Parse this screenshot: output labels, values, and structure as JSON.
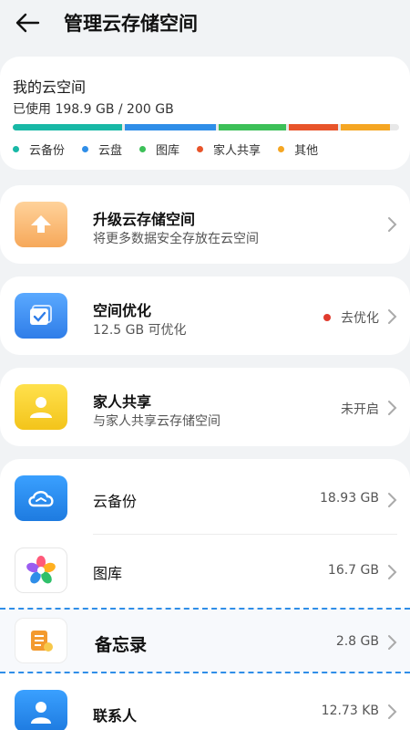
{
  "header": {
    "title": "管理云存储空间"
  },
  "storage": {
    "title": "我的云空间",
    "used_text": "已使用 198.9 GB / 200 GB",
    "legend": [
      {
        "label": "云备份",
        "color": "#18b8a6"
      },
      {
        "label": "云盘",
        "color": "#2f8ee8"
      },
      {
        "label": "图库",
        "color": "#3cc058"
      },
      {
        "label": "家人共享",
        "color": "#e8542a"
      },
      {
        "label": "其他",
        "color": "#f5a623"
      }
    ]
  },
  "upgrade": {
    "title": "升级云存储空间",
    "subtitle": "将更多数据安全存放在云空间"
  },
  "optimize": {
    "title": "空间优化",
    "subtitle": "12.5 GB 可优化",
    "action": "去优化",
    "dot_color": "#e03b2e"
  },
  "family": {
    "title": "家人共享",
    "subtitle": "与家人共享云存储空间",
    "status": "未开启"
  },
  "apps": [
    {
      "label": "云备份",
      "size": "18.93 GB"
    },
    {
      "label": "图库",
      "size": "16.7 GB"
    },
    {
      "label": "备忘录",
      "size": "2.8 GB"
    },
    {
      "label": "联系人",
      "size": "12.73 KB"
    }
  ]
}
